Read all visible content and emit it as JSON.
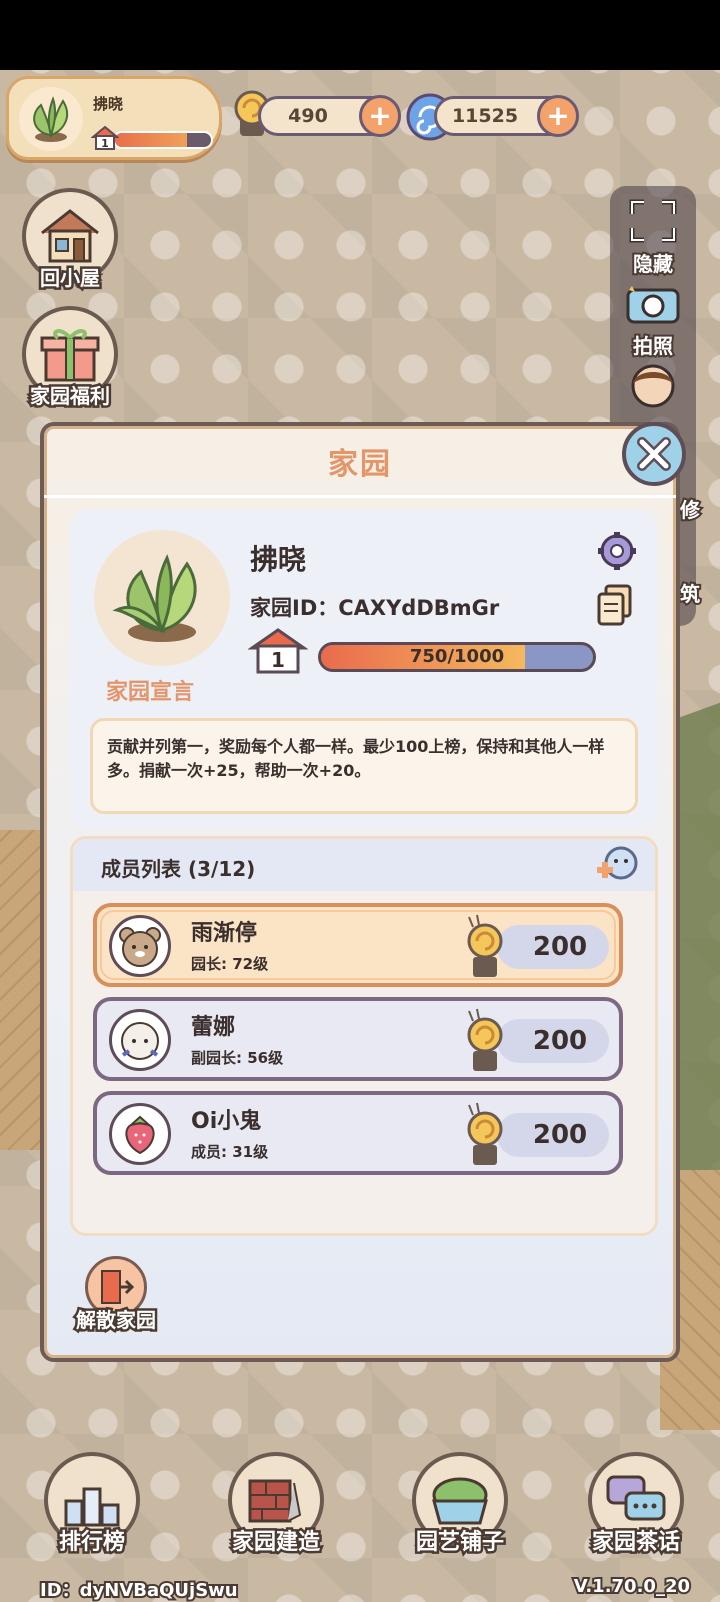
{
  "hud": {
    "player_name": "拂晓",
    "level": "1",
    "level_progress": 0.75,
    "snail_coins": "490",
    "gems": "11525"
  },
  "left_buttons": {
    "home": "回小屋",
    "welfare": "家园福利"
  },
  "right_tools": {
    "hide": "隐藏",
    "photo": "拍照",
    "decorate_partial": "修",
    "build_partial": "筑"
  },
  "modal": {
    "title": "家园",
    "garden_name": "拂晓",
    "garden_id": "家园ID：CAXYdDBmGr",
    "level": "1",
    "exp_text": "750/1000",
    "exp_progress": 0.75,
    "manifesto_label": "家园宣言",
    "manifesto_text": "贡献并列第一，奖励每个人都一样。最少100上榜，保持和其他人一样多。捐献一次+25，帮助一次+20。",
    "members_title": "成员列表 (3/12)",
    "members": [
      {
        "name": "雨渐停",
        "role": "园长: 72级",
        "score": "200"
      },
      {
        "name": "蕾娜",
        "role": "副园长: 56级",
        "score": "200"
      },
      {
        "name": "Oi小鬼",
        "role": "成员: 31级",
        "score": "200"
      }
    ],
    "disband_label": "解散家园"
  },
  "bottom_nav": {
    "ranking": "排行榜",
    "build": "家园建造",
    "shop": "园艺铺子",
    "chat": "家园茶话"
  },
  "footer": {
    "user_id": "ID：dyNVBaQUjSwu",
    "version": "V.1.70.0_20"
  },
  "colors": {
    "accent": "#e3966a",
    "frame": "#6d5b55",
    "exp_bar": "#e96b4d"
  }
}
